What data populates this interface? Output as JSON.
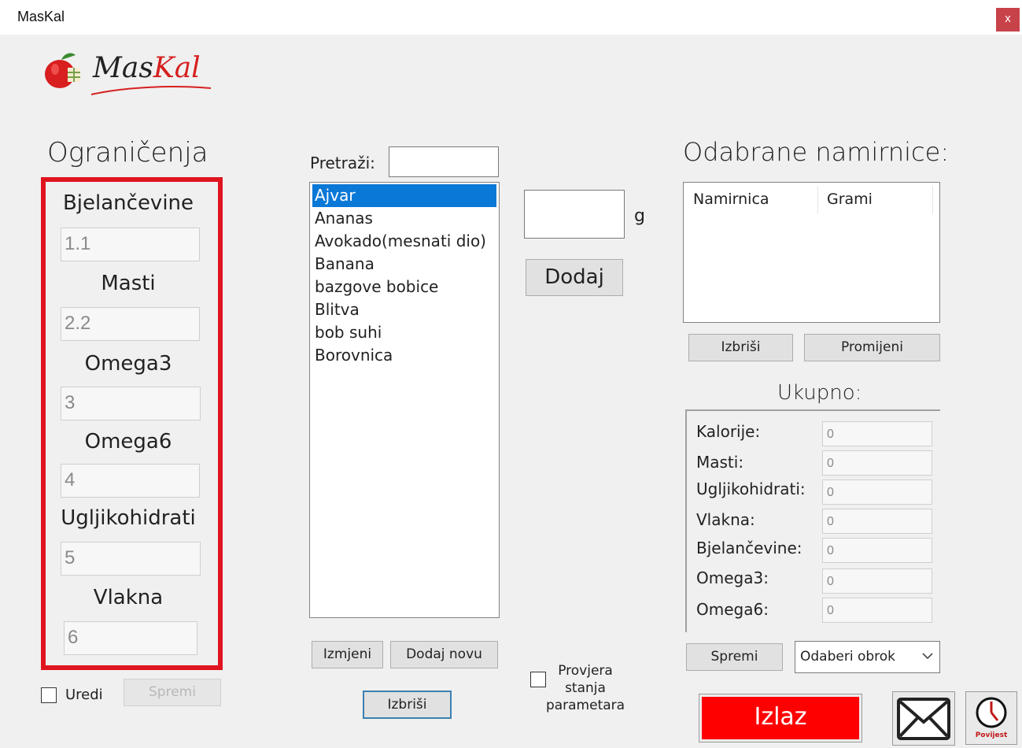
{
  "window": {
    "title": "MasKal",
    "close_label": "x"
  },
  "logo": {
    "part1": "Mas",
    "part2": "Kal"
  },
  "restrictions": {
    "heading": "Ograničenja",
    "fields": [
      {
        "label": "Bjelančevine",
        "value": "1.1"
      },
      {
        "label": "Masti",
        "value": "2.2"
      },
      {
        "label": "Omega3",
        "value": "3"
      },
      {
        "label": "Omega6",
        "value": "4"
      },
      {
        "label": "Ugljikohidrati",
        "value": "5"
      },
      {
        "label": "Vlakna",
        "value": "6"
      }
    ],
    "edit_checkbox_label": "Uredi",
    "save_label": "Spremi",
    "border_color": "#e0141e"
  },
  "search": {
    "label": "Pretraži:",
    "value": ""
  },
  "foods": {
    "items": [
      "Ajvar",
      "Ananas",
      "Avokado(mesnati dio)",
      "Banana",
      "bazgove bobice",
      "Blitva",
      "bob suhi",
      "Borovnica"
    ],
    "selected": "Ajvar",
    "edit_label": "Izmjeni",
    "add_new_label": "Dodaj novu",
    "delete_label": "Izbriši"
  },
  "amount": {
    "value": "",
    "unit": "g",
    "add_label": "Dodaj"
  },
  "check_params": {
    "label": "Provjera stanja parametara"
  },
  "selected_foods": {
    "heading": "Odabrane namirnice:",
    "columns": [
      "Namirnica",
      "Grami"
    ],
    "delete_label": "Izbriši",
    "change_label": "Promijeni"
  },
  "totals": {
    "heading": "Ukupno:",
    "rows": [
      {
        "label": "Kalorije:",
        "value": "0"
      },
      {
        "label": "Masti:",
        "value": "0"
      },
      {
        "label": "Ugljikohidrati:",
        "value": "0"
      },
      {
        "label": "Vlakna:",
        "value": "0"
      },
      {
        "label": "Bjelančevine:",
        "value": "0"
      },
      {
        "label": "Omega3:",
        "value": "0"
      },
      {
        "label": "Omega6:",
        "value": "0"
      }
    ],
    "save_label": "Spremi",
    "meal_select": "Odaberi obrok"
  },
  "exit": {
    "label": "Izlaz",
    "color": "#ff0000"
  },
  "icons": {
    "mail": "envelope-icon",
    "history": "history-clock-icon",
    "history_caption": "Povijest"
  }
}
